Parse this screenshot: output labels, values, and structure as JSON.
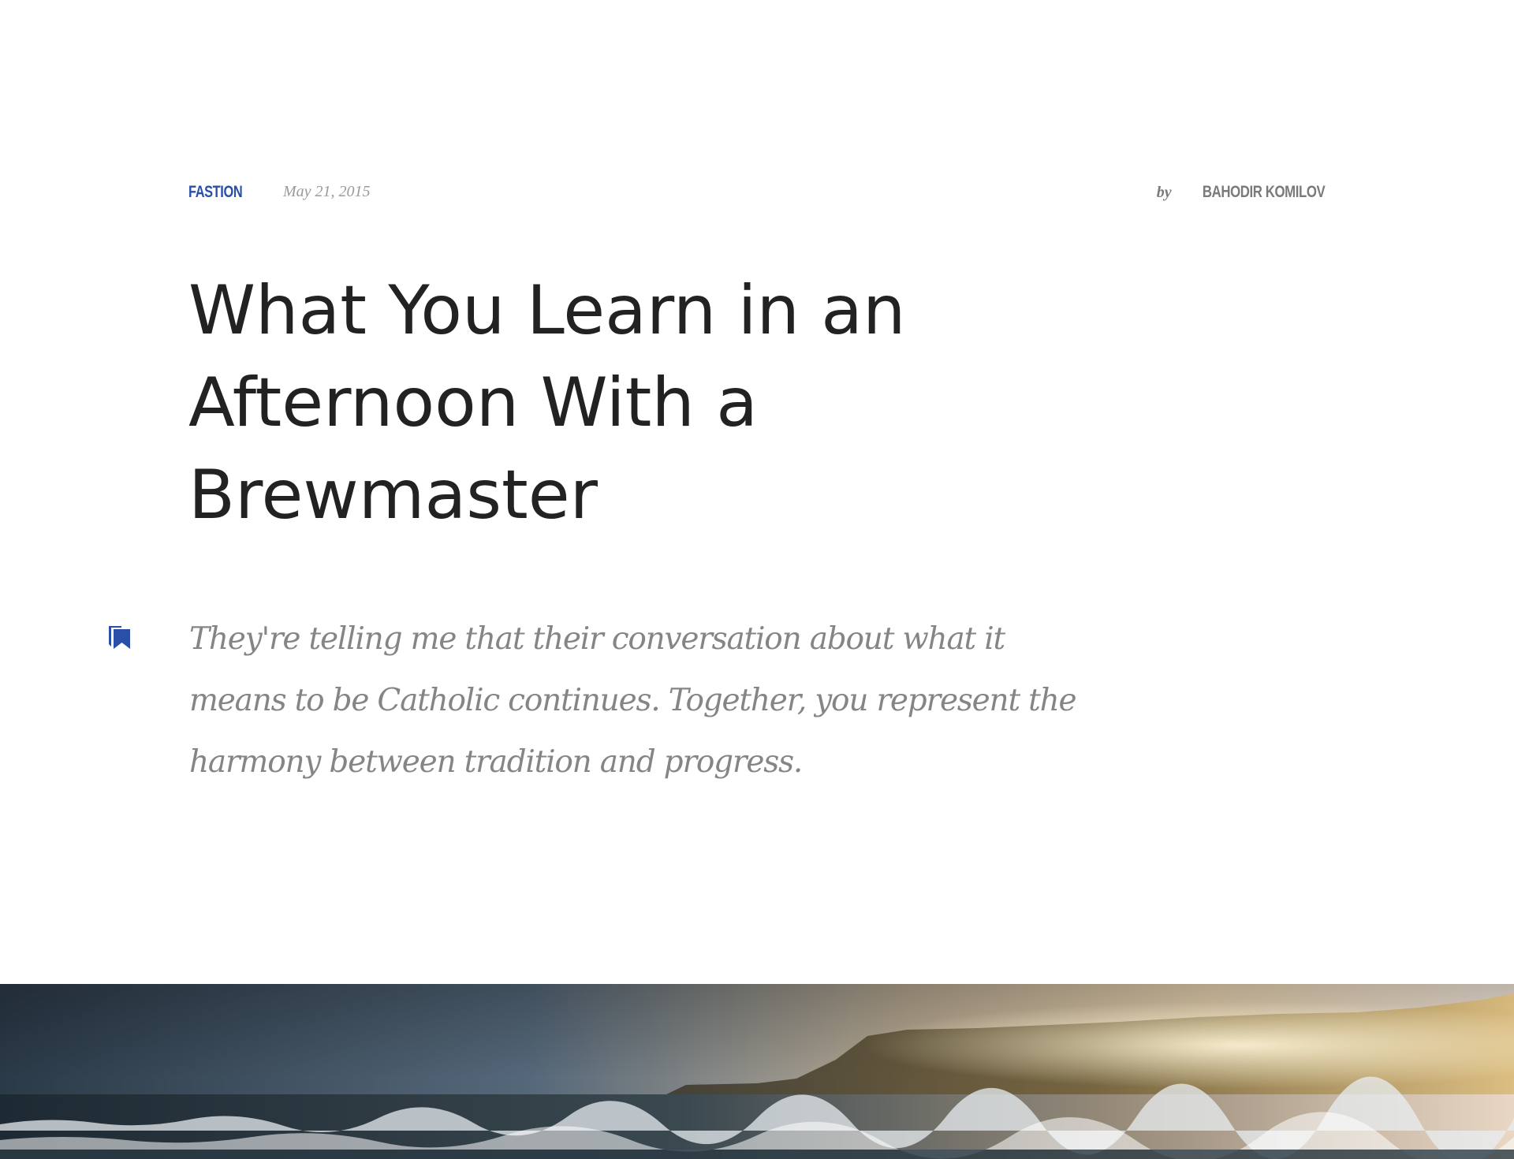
{
  "article": {
    "category": "FASTION",
    "date": "May 21, 2015",
    "byline_prefix": "by",
    "author": "BAHODIR KOMILOV",
    "title": "What You Learn in an Afternoon With a Brewmaster",
    "quote": "They're telling me that their conversation about what it means to be Catholic continues. Together, you represent the harmony between tradition and progress.",
    "quote_icon": "bookmark-icon",
    "hero_image": "coastal-sea-waves-photo"
  },
  "colors": {
    "accent": "#2a4fa8",
    "title": "#222222",
    "quote": "#858585",
    "meta": "#9a9a9a",
    "background": "#ffffff"
  }
}
